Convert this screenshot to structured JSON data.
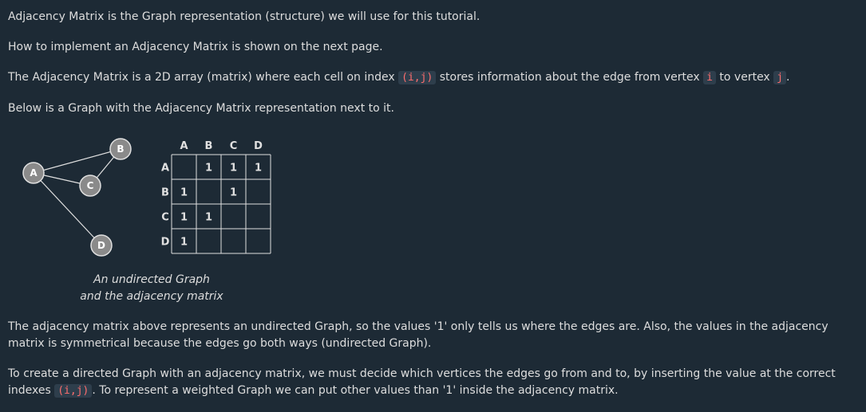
{
  "paragraphs": {
    "p1": "Adjacency Matrix is the Graph representation (structure) we will use for this tutorial.",
    "p2": "How to implement an Adjacency Matrix is shown on the next page.",
    "p3": {
      "before": "The Adjacency Matrix is a 2D array (matrix) where each cell on index ",
      "code1": "(i,j)",
      "mid1": " stores information about the edge from vertex ",
      "code2": "i",
      "mid2": " to vertex ",
      "code3": "j",
      "after": "."
    },
    "p4": "Below is a Graph with the Adjacency Matrix representation next to it.",
    "p5": "The adjacency matrix above represents an undirected Graph, so the values '1' only tells us where the edges are. Also, the values in the adjacency matrix is symmetrical because the edges go both ways (undirected Graph).",
    "p6": {
      "before": "To create a directed Graph with an adjacency matrix, we must decide which vertices the edges go from and to, by inserting the value at the correct indexes ",
      "code1": "(i,j)",
      "after": ". To represent a weighted Graph we can put other values than '1' inside the adjacency matrix."
    }
  },
  "figure": {
    "caption_line1": "An undirected Graph",
    "caption_line2": "and the adjacency matrix",
    "node_fill": "#8a8a8a",
    "node_stroke": "#e0e0e0",
    "edge_color": "#e0e0e0",
    "grid_color": "#e0e0e0",
    "nodes": [
      {
        "id": "A",
        "label": "A"
      },
      {
        "id": "B",
        "label": "B"
      },
      {
        "id": "C",
        "label": "C"
      },
      {
        "id": "D",
        "label": "D"
      }
    ],
    "edges": [
      [
        "A",
        "B"
      ],
      [
        "A",
        "C"
      ],
      [
        "A",
        "D"
      ],
      [
        "B",
        "C"
      ]
    ],
    "matrix": {
      "col_labels": [
        "A",
        "B",
        "C",
        "D"
      ],
      "row_labels": [
        "A",
        "B",
        "C",
        "D"
      ],
      "values": [
        [
          "",
          "1",
          "1",
          "1"
        ],
        [
          "1",
          "",
          "1",
          ""
        ],
        [
          "1",
          "1",
          "",
          ""
        ],
        [
          "1",
          "",
          "",
          ""
        ]
      ]
    }
  }
}
